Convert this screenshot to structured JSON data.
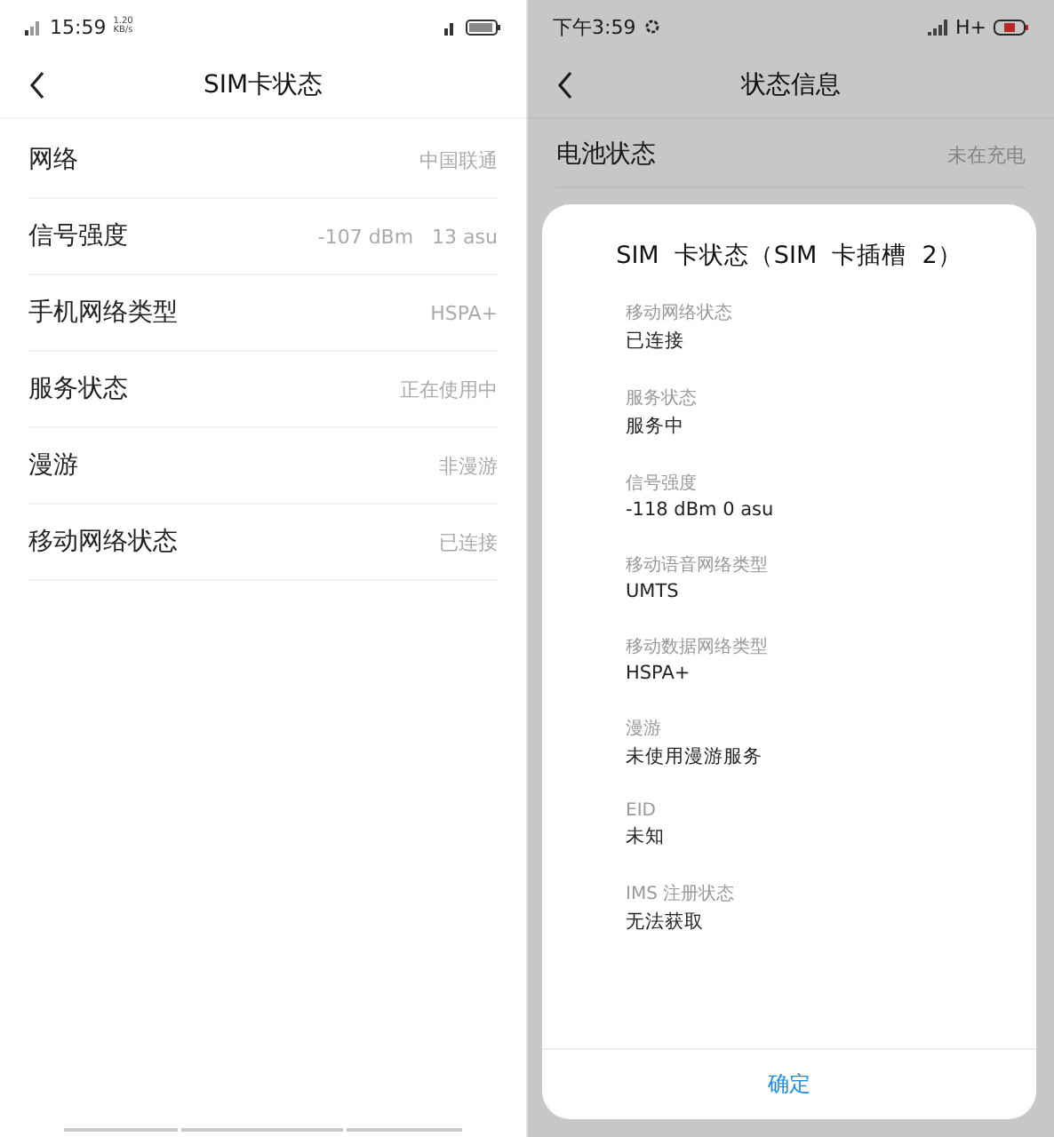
{
  "left": {
    "status_bar": {
      "time": "15:59",
      "speed": "1.20",
      "speed_unit": "KB/s"
    },
    "header": {
      "title": "SIM卡状态"
    },
    "rows": [
      {
        "label": "网络",
        "value": "中国联通"
      },
      {
        "label": "信号强度",
        "value": "-107 dBm   13 asu"
      },
      {
        "label": "手机网络类型",
        "value": "HSPA+"
      },
      {
        "label": "服务状态",
        "value": "正在使用中"
      },
      {
        "label": "漫游",
        "value": "非漫游"
      },
      {
        "label": "移动网络状态",
        "value": "已连接"
      }
    ]
  },
  "right": {
    "status_bar": {
      "time": "下午3:59",
      "network": "H+"
    },
    "header": {
      "title": "状态信息"
    },
    "rows": [
      {
        "label": "电池状态",
        "value": "未在充电"
      }
    ],
    "dialog": {
      "title": "SIM  卡状态（SIM  卡插槽  2）",
      "items": [
        {
          "label": "移动网络状态",
          "value": "已连接"
        },
        {
          "label": "服务状态",
          "value": "服务中"
        },
        {
          "label": "信号强度",
          "value": "-118 dBm 0 asu"
        },
        {
          "label": "移动语音网络类型",
          "value": "UMTS"
        },
        {
          "label": "移动数据网络类型",
          "value": "HSPA+"
        },
        {
          "label": "漫游",
          "value": "未使用漫游服务"
        },
        {
          "label": "EID",
          "value": "未知"
        },
        {
          "label": "IMS 注册状态",
          "value": "无法获取"
        }
      ],
      "button": "确定"
    }
  }
}
